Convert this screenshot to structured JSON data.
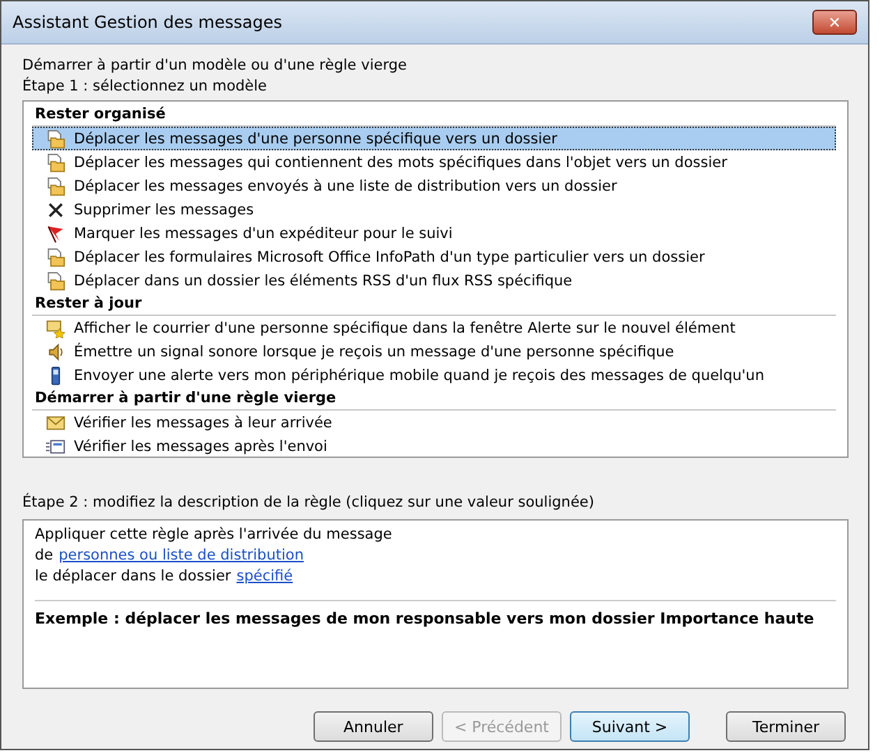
{
  "window": {
    "title": "Assistant Gestion des messages",
    "close_label": "✕"
  },
  "intro": "Démarrer à partir d'un modèle ou d'une règle vierge",
  "step1": "Étape 1 : sélectionnez un modèle",
  "groups": [
    {
      "title": "Rester organisé",
      "items": [
        {
          "kind": "move",
          "label": "Déplacer les messages d'une personne spécifique vers un dossier",
          "selected": true
        },
        {
          "kind": "move",
          "label": "Déplacer les messages qui contiennent des mots spécifiques dans l'objet vers un dossier",
          "selected": false
        },
        {
          "kind": "move",
          "label": "Déplacer les messages envoyés à une liste de distribution vers un dossier",
          "selected": false
        },
        {
          "kind": "delete",
          "label": "Supprimer les messages",
          "selected": false
        },
        {
          "kind": "flag",
          "label": "Marquer les messages d'un expéditeur pour le suivi",
          "selected": false
        },
        {
          "kind": "move",
          "label": "Déplacer les formulaires Microsoft Office InfoPath d'un type particulier vers un dossier",
          "selected": false
        },
        {
          "kind": "move",
          "label": "Déplacer dans un dossier les éléments RSS d'un flux RSS spécifique",
          "selected": false
        }
      ]
    },
    {
      "title": "Rester à jour",
      "items": [
        {
          "kind": "alert",
          "label": "Afficher le courrier d'une personne spécifique dans la fenêtre Alerte sur le nouvel élément",
          "selected": false
        },
        {
          "kind": "sound",
          "label": "Émettre un signal sonore lorsque je reçois un message d'une personne spécifique",
          "selected": false
        },
        {
          "kind": "mobile",
          "label": "Envoyer une alerte vers mon périphérique mobile quand je reçois des messages de quelqu'un",
          "selected": false
        }
      ]
    },
    {
      "title": "Démarrer à partir d'une règle vierge",
      "items": [
        {
          "kind": "arrival",
          "label": "Vérifier les messages à leur arrivée",
          "selected": false
        },
        {
          "kind": "sent",
          "label": "Vérifier les messages après l'envoi",
          "selected": false
        }
      ]
    }
  ],
  "step2": "Étape 2 : modifiez la description de la règle (cliquez sur une valeur soulignée)",
  "description": [
    [
      {
        "text": "Appliquer cette règle après l'arrivée du message",
        "link": false
      }
    ],
    [
      {
        "text": "de",
        "link": false
      },
      {
        "text": "personnes ou liste de distribution",
        "link": true
      }
    ],
    [
      {
        "text": "le déplacer dans le dossier",
        "link": false
      },
      {
        "text": "spécifié",
        "link": true
      }
    ]
  ],
  "example": "Exemple : déplacer les messages de mon responsable vers mon dossier Importance haute",
  "buttons": [
    {
      "label": "Annuler",
      "disabled": false,
      "default": false
    },
    {
      "label": "< Précédent",
      "disabled": true,
      "default": false
    },
    {
      "label": "Suivant >",
      "disabled": false,
      "default": true
    },
    {
      "label": "Terminer",
      "disabled": false,
      "default": false
    }
  ]
}
